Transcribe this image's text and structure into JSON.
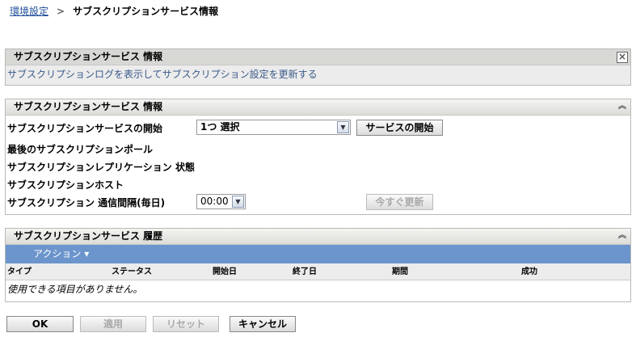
{
  "breadcrumb": {
    "parent": "環境設定",
    "separator": ">",
    "current": "サブスクリプションサービス情報"
  },
  "info_panel": {
    "title": "サブスクリプションサービス 情報",
    "description": "サブスクリプションログを表示してサブスクリプション設定を更新する"
  },
  "settings_panel": {
    "title": "サブスクリプションサービス 情報",
    "start_label": "サブスクリプションサービスの開始",
    "start_select": "1つ 選択",
    "start_button": "サービスの開始",
    "last_poll_label": "最後のサブスクリプションポール",
    "replication_label": "サブスクリプションレプリケーション 状態",
    "host_label": "サブスクリプションホスト",
    "interval_label": "サブスクリプション 通信間隔(毎日)",
    "interval_select": "00:00",
    "update_button": "今すぐ更新"
  },
  "history_panel": {
    "title": "サブスクリプションサービス 履歴",
    "actions": "アクション ▾",
    "columns": [
      "タイプ",
      "ステータス",
      "開始日",
      "終了日",
      "期間",
      "成功"
    ],
    "empty": "使用できる項目がありません。"
  },
  "footer": {
    "ok": "OK",
    "apply": "適用",
    "reset": "リセット",
    "cancel": "キャンセル"
  }
}
